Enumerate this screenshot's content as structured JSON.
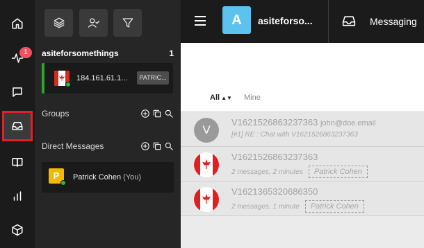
{
  "rail": {
    "badge_count": "1",
    "items": [
      {
        "icon": "home-icon"
      },
      {
        "icon": "activity-icon"
      },
      {
        "icon": "chat-icon"
      },
      {
        "icon": "inbox-icon",
        "active": true
      },
      {
        "icon": "book-icon"
      },
      {
        "icon": "bar-chart-icon"
      },
      {
        "icon": "package-icon"
      }
    ]
  },
  "sidebar": {
    "tools": [
      "layers-icon",
      "user-check-icon",
      "filter-icon"
    ],
    "site_name": "asiteforsomethings",
    "site_count": "1",
    "active_conversation": {
      "ip": "184.161.61.1...",
      "tag": "PATRIC...",
      "status_color": "#2fb344"
    },
    "groups_label": "Groups",
    "direct_messages_label": "Direct Messages",
    "dm": {
      "initial": "P",
      "name": "Patrick Cohen",
      "suffix": "(You)"
    }
  },
  "topbar": {
    "site_initial": "A",
    "site_name": "asiteforso...",
    "section_title": "Messaging"
  },
  "filters": {
    "all_label": "All",
    "mine_label": "Mine"
  },
  "chats": [
    {
      "avatar": "V",
      "title": "V1621526863237363",
      "email": "john@doe.email",
      "subtitle": "[#1] RE : Chat with V1621526863237363",
      "assignee": ""
    },
    {
      "avatar": "flag-ca",
      "title": "V1621526863237363",
      "email": "",
      "subtitle": "2 messages, 2 minutes",
      "assignee": "Patrick Cohen"
    },
    {
      "avatar": "flag-ca",
      "title": "V1621365320686350",
      "email": "",
      "subtitle": "2 messages, 1 minute",
      "assignee": "Patrick Cohen"
    }
  ],
  "colors": {
    "brand_avatar": "#5cc3f0",
    "active_border": "#e0202b",
    "online": "#2fb344",
    "dm_avatar": "#f5b800"
  }
}
